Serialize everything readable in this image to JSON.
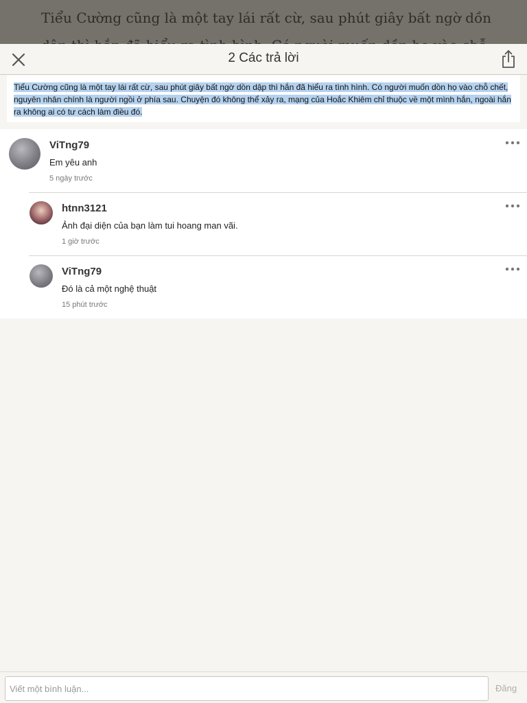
{
  "reader": {
    "background_text": "Tiểu Cường cũng là một tay lái rất cừ, sau phút giây bất ngờ dồn dập thì hắn đã hiểu ra tình hình. Có người muốn dồn họ vào chỗ chết, nguyên"
  },
  "header": {
    "title": "2 Các trả lời",
    "close_icon": "close-icon",
    "share_icon": "share-icon"
  },
  "quote": {
    "text": "Tiểu Cường cũng là một tay lái rất cừ, sau phút giây bất ngờ dồn dập thì hắn đã hiểu ra tình hình. Có người muốn dồn họ vào chỗ chết, nguyên nhân chính là người ngồi ở phía sau. Chuyện đó không thể xảy ra, mạng của Hoắc Khiêm chỉ thuộc về một mình hắn, ngoài hắn ra không ai có tư cách làm điều đó.",
    "highlight_color": "#b5d2ee"
  },
  "comments": [
    {
      "username": "ViTng79",
      "text": "Em  yêu anh",
      "time": "5 ngày trước"
    },
    {
      "username": "htnn3121",
      "text": "Ảnh đại diện của bạn làm tui hoang man vãi.",
      "time": "1 giờ trước"
    },
    {
      "username": "ViTng79",
      "text": "Đó là cả một nghệ thuật",
      "time": "15 phút trước"
    }
  ],
  "composer": {
    "placeholder": "Viết một bình luận...",
    "post_label": "Đăng"
  }
}
